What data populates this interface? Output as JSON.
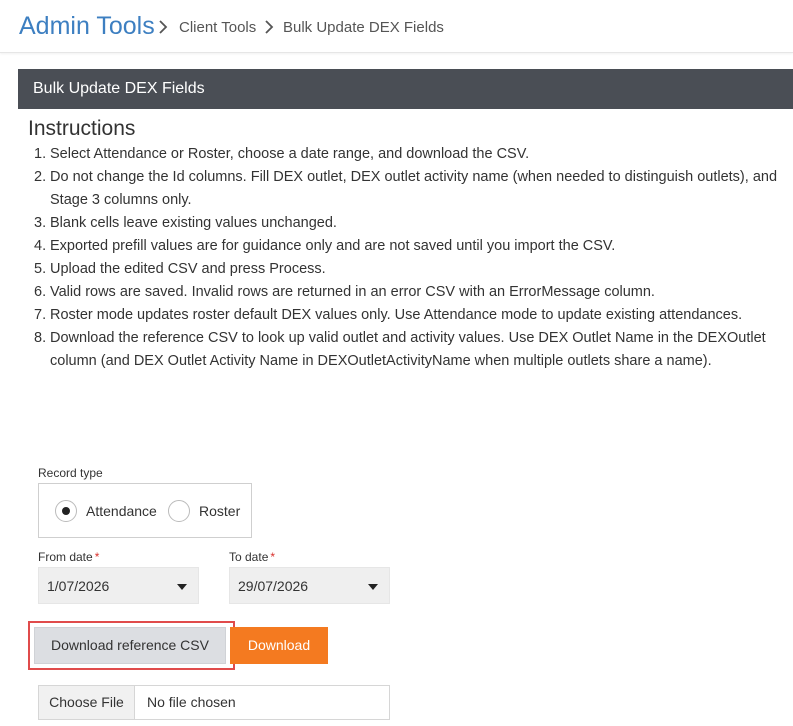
{
  "header": {
    "app_title": "Admin Tools",
    "breadcrumb": [
      "Client Tools",
      "Bulk Update DEX Fields"
    ],
    "separator_icon": "chevron-right-icon"
  },
  "panel": {
    "title": "Bulk Update DEX Fields"
  },
  "instructions": {
    "title": "Instructions",
    "items": [
      {
        "num": "1.",
        "text": "Select Attendance or Roster, choose a date range, and download the CSV."
      },
      {
        "num": "2.",
        "text": "Do not change the Id columns. Fill DEX outlet, DEX outlet activity name (when needed to distinguish outlets), and Stage 3 columns only."
      },
      {
        "num": "3.",
        "text": "Blank cells leave existing values unchanged."
      },
      {
        "num": "4.",
        "text": "Exported prefill values are for guidance only and are not saved until you import the CSV."
      },
      {
        "num": "5.",
        "text": "Upload the edited CSV and press Process."
      },
      {
        "num": "6.",
        "text": "Valid rows are saved. Invalid rows are returned in an error CSV with an ErrorMessage column."
      },
      {
        "num": "7.",
        "text": "Roster mode updates roster default DEX values only. Use Attendance mode to update existing attendances."
      },
      {
        "num": "8.",
        "text": "Download the reference CSV to look up valid outlet and activity values. Use DEX Outlet Name in the DEXOutlet column (and DEX Outlet Activity Name in DEXOutletActivityName when multiple outlets share a name)."
      }
    ]
  },
  "form": {
    "record_type_label": "Record type",
    "record_type_options": [
      {
        "label": "Attendance",
        "checked": true
      },
      {
        "label": "Roster",
        "checked": false
      }
    ],
    "from_date_label": "From date",
    "from_date_value": "1/07/2026",
    "to_date_label": "To date",
    "to_date_value": "29/07/2026",
    "required_mark": "*",
    "download_reference_label": "Download reference CSV",
    "download_label": "Download",
    "choose_file_label": "Choose File",
    "file_status": "No file chosen"
  },
  "colors": {
    "brand_blue": "#3d7fc1",
    "header_dark": "#4a4e55",
    "accent_orange": "#f47a20",
    "highlight_red": "#e04b4b",
    "required_red": "#d9302c"
  }
}
